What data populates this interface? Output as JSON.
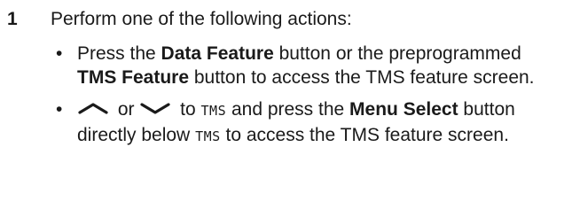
{
  "step": {
    "number": "1",
    "instruction": "Perform one of the following actions:"
  },
  "bullets": [
    {
      "marker": "•",
      "parts": {
        "t1": "Press the ",
        "b1": "Data Feature",
        "t2": " button or the preprogrammed ",
        "b2": "TMS Feature",
        "t3": " button to access the TMS feature screen."
      }
    },
    {
      "marker": "•",
      "parts": {
        "or": " or ",
        "to": " to ",
        "display1": "TMS",
        "t1": " and press the ",
        "b1": "Menu Select",
        "t2": " button directly below ",
        "display2": "TMS",
        "t3": " to access the TMS feature screen."
      },
      "icons": [
        "up-arrow-icon",
        "down-arrow-icon"
      ]
    }
  ]
}
